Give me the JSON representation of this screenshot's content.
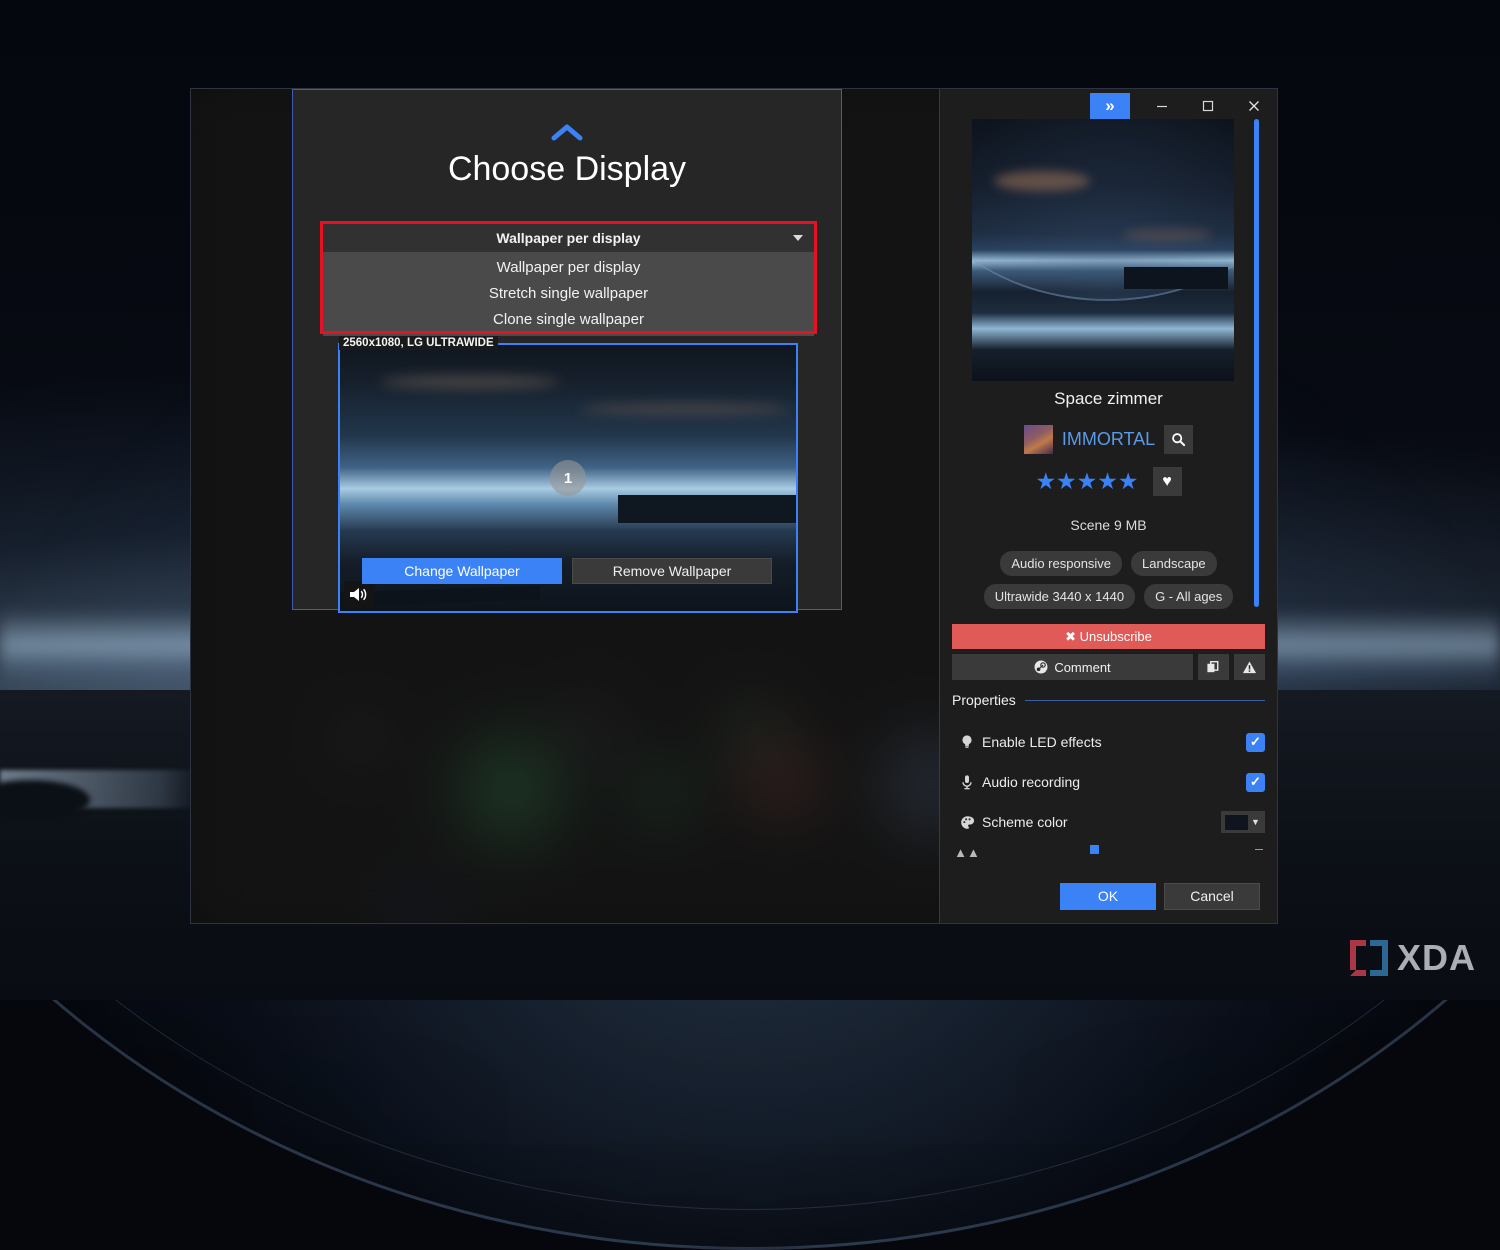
{
  "desktop": {
    "wallpaper_name": "space-dome-scene"
  },
  "titlebar": {
    "expand_label": "»",
    "minimize_label": "—",
    "maximize_label": "⬜",
    "close_label": "✕"
  },
  "modal": {
    "collapse_caret": "⌃",
    "title": "Choose Display",
    "select": {
      "value": "Wallpaper per display",
      "options": [
        "Wallpaper per display",
        "Stretch single wallpaper",
        "Clone single wallpaper"
      ]
    },
    "monitor": {
      "label": "2560x1080, LG ULTRAWIDE",
      "number": "1",
      "audio_icon": "speaker-icon"
    },
    "buttons": {
      "change": "Change Wallpaper",
      "remove": "Remove Wallpaper"
    }
  },
  "detail": {
    "wallpaper_title": "Space zimmer",
    "author": "IMMORTAL",
    "search_icon": "🔍",
    "stars": "★★★★★",
    "star_count": 5,
    "favorite_icon": "♥",
    "type": "Scene",
    "size": "9 MB",
    "type_size": "Scene  9 MB",
    "tags": [
      "Audio responsive",
      "Landscape",
      "Ultrawide 3440 x 1440",
      "G - All ages"
    ],
    "unsubscribe": "✖ Unsubscribe",
    "comment": "Comment",
    "copy_icon": "⧉",
    "report_icon": "⚠",
    "properties_header": "Properties",
    "properties": [
      {
        "icon": "lightbulb-icon",
        "label": "Enable LED effects",
        "control": "checkbox",
        "checked": true
      },
      {
        "icon": "microphone-icon",
        "label": "Audio recording",
        "control": "checkbox",
        "checked": true
      },
      {
        "icon": "palette-icon",
        "label": "Scheme color",
        "control": "color",
        "color": "#10141f"
      }
    ],
    "footer": {
      "ok": "OK",
      "cancel": "Cancel"
    }
  },
  "watermark": {
    "text": "XDA",
    "bracket_red": "#b83a4b",
    "bracket_blue": "#2f6f9e"
  },
  "colors": {
    "accent_blue": "#3b82f6",
    "danger_red": "#e05a57",
    "annotation_red": "#e81123",
    "panel_bg": "#1d1d1d",
    "modal_bg": "#262626"
  }
}
